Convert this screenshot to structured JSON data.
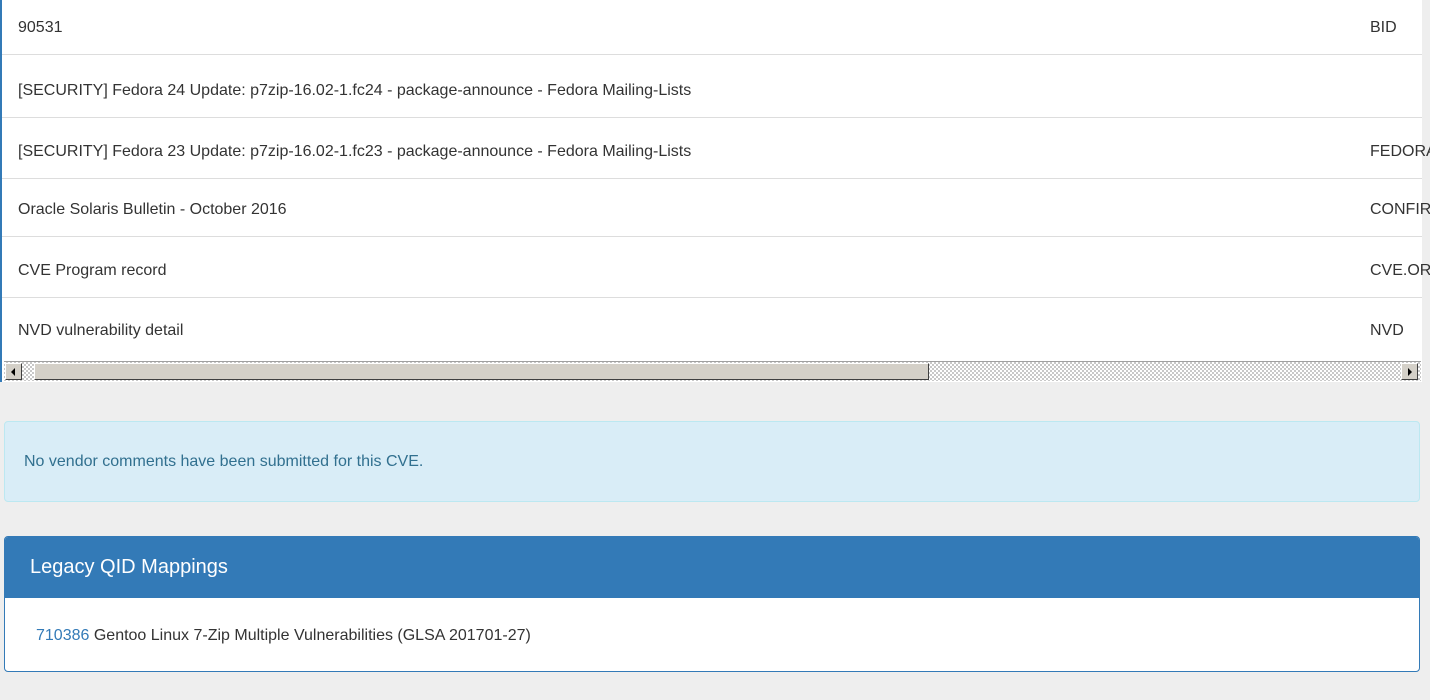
{
  "references": [
    {
      "title": "90531",
      "source": "BID"
    },
    {
      "title": "[SECURITY] Fedora 24 Update: p7zip-16.02-1.fc24 - package-announce - Fedora Mailing-Lists",
      "source": ""
    },
    {
      "title": "[SECURITY] Fedora 23 Update: p7zip-16.02-1.fc23 - package-announce - Fedora Mailing-Lists",
      "source": "FEDORA"
    },
    {
      "title": "Oracle Solaris Bulletin - October 2016",
      "source": "CONFIRM"
    },
    {
      "title": "CVE Program record",
      "source": "CVE.ORG"
    },
    {
      "title": "NVD vulnerability detail",
      "source": "NVD"
    }
  ],
  "vendor_comments": {
    "message": "No vendor comments have been submitted for this CVE."
  },
  "legacy_qid": {
    "heading": "Legacy QID Mappings",
    "items": [
      {
        "qid": "710386",
        "title": "Gentoo Linux 7-Zip Multiple Vulnerabilities (GLSA 201701-27)"
      }
    ]
  },
  "colors": {
    "primary": "#337ab7",
    "info_bg": "#d9edf7",
    "info_text": "#31708f",
    "page_bg": "#eeeeee"
  }
}
